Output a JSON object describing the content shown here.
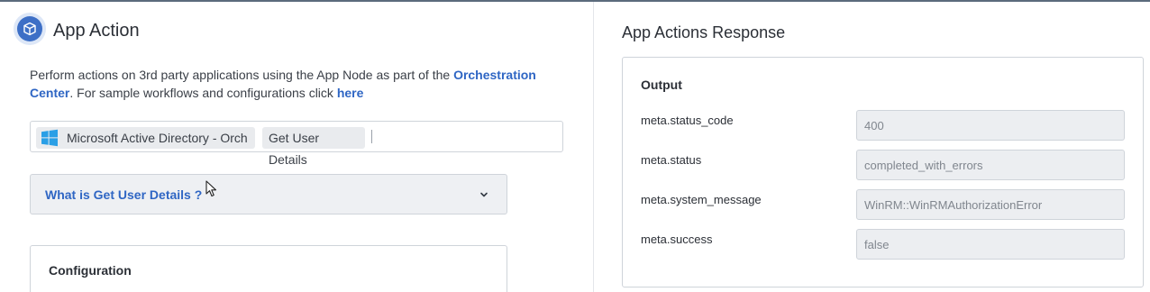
{
  "app_action": {
    "title": "App Action",
    "description_prefix": "Perform actions on 3rd party applications using the App Node as part of the ",
    "description_link": "Orchestration Center",
    "description_middle": ". For sample workflows and configurations click ",
    "description_here": "here",
    "selector": {
      "app_chip": "Microsoft Active Directory - Orch",
      "action_chip": "Get User Details"
    },
    "accordion_label": "What is Get User Details ?",
    "configuration_label": "Configuration"
  },
  "response": {
    "title": "App Actions Response",
    "output_label": "Output",
    "fields": [
      {
        "label": "meta.status_code",
        "value": "400"
      },
      {
        "label": "meta.status",
        "value": "completed_with_errors"
      },
      {
        "label": "meta.system_message",
        "value": "WinRM::WinRMAuthorizationError"
      },
      {
        "label": "meta.success",
        "value": "false"
      }
    ]
  },
  "colors": {
    "accent": "#2f66c4",
    "icon_blue": "#3d6fc6",
    "windows_blue": "#2a9fe6"
  },
  "icons": {
    "app": "cube-icon",
    "app_chip": "windows-logo-icon",
    "accordion": "chevron-down-icon"
  }
}
